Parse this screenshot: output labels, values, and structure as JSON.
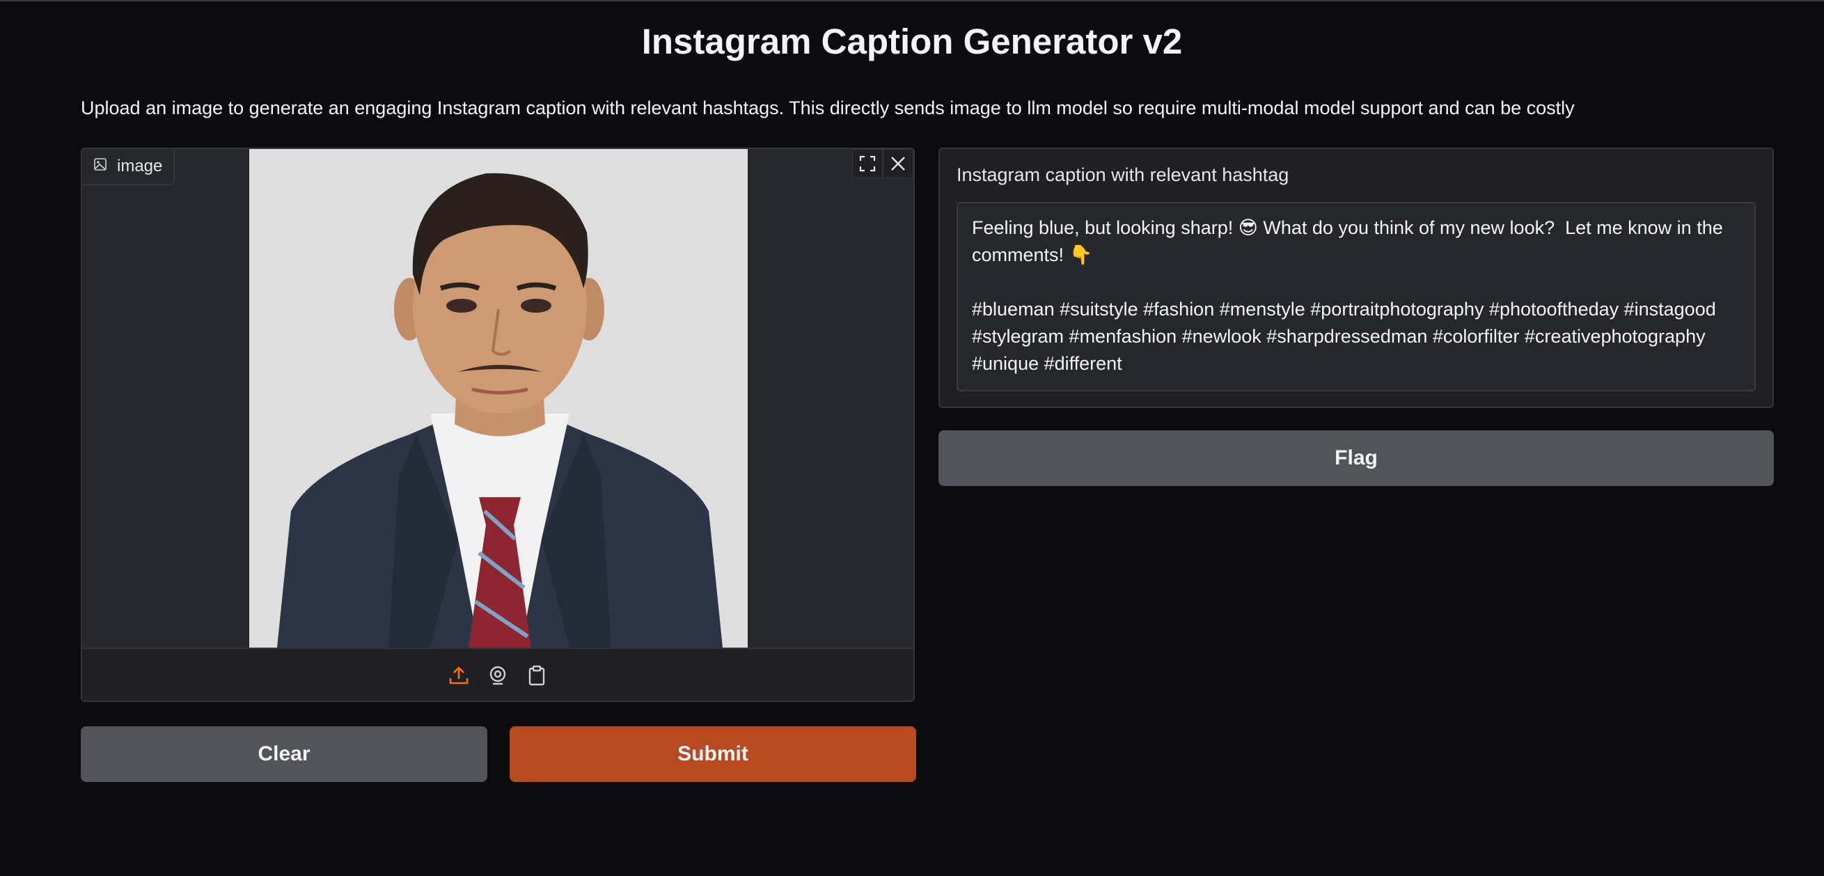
{
  "header": {
    "title": "Instagram Caption Generator v2",
    "description": "Upload an image to generate an engaging Instagram caption with relevant hashtags. This directly sends image to llm model so require multi-modal model support and can be costly"
  },
  "image_input": {
    "label": "image",
    "icon": "image-icon",
    "tools": [
      "fullscreen-icon",
      "close-icon"
    ],
    "sources": [
      "upload-icon",
      "webcam-icon",
      "clipboard-icon"
    ],
    "accent_color": "#f97316"
  },
  "buttons": {
    "clear": "Clear",
    "submit": "Submit",
    "flag": "Flag"
  },
  "output": {
    "label": "Instagram caption with relevant hashtag",
    "text": "Feeling blue, but looking sharp! 😎 What do you think of my new look?  Let me know in the comments! 👇\n\n#blueman #suitstyle #fashion #menstyle #portraitphotography #photooftheday #instagood #stylegram #menfashion #newlook #sharpdressedman #colorfilter #creativephotography #unique #different"
  },
  "colors": {
    "background": "#0c0c0f",
    "panel": "#1f1f24",
    "primary_button": "#b84a22",
    "secondary_button": "#52535b"
  }
}
